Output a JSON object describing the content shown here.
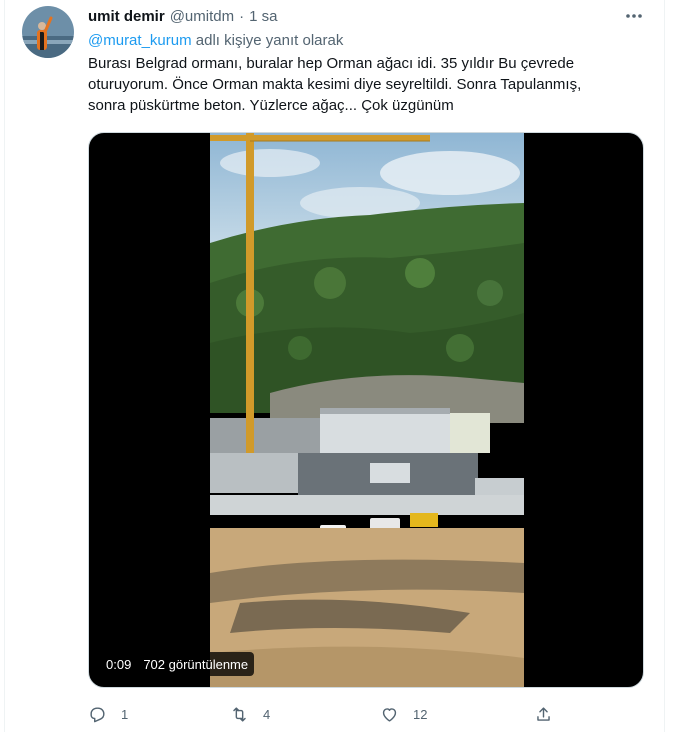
{
  "tweet": {
    "author_name": "umit demir",
    "author_handle": "@umitdm",
    "separator": "·",
    "time_ago": "1 sa",
    "reply_mention": "@murat_kurum",
    "reply_suffix": "adlı kişiye yanıt olarak",
    "text_lines": [
      "Burası Belgrad ormanı, buralar hep Orman ağacı idi. 35 yıldır Bu çevrede",
      "oturuyorum. Önce Orman makta kesimi diye seyreltildi. Sonra Tapulanmış,",
      "sonra püskürtme beton. Yüzlerce ağaç... Çok üzgünüm"
    ]
  },
  "media": {
    "duration": "0:09",
    "views": "702 görüntülenme"
  },
  "actions": {
    "reply_count": "1",
    "retweet_count": "4",
    "like_count": "12"
  },
  "icons": {
    "more": "more-horizontal-icon",
    "reply": "reply-icon",
    "retweet": "retweet-icon",
    "like": "heart-icon",
    "share": "share-icon"
  },
  "colors": {
    "accent": "#1d9bf0",
    "secondary_text": "#536471",
    "primary_text": "#0f1419"
  }
}
